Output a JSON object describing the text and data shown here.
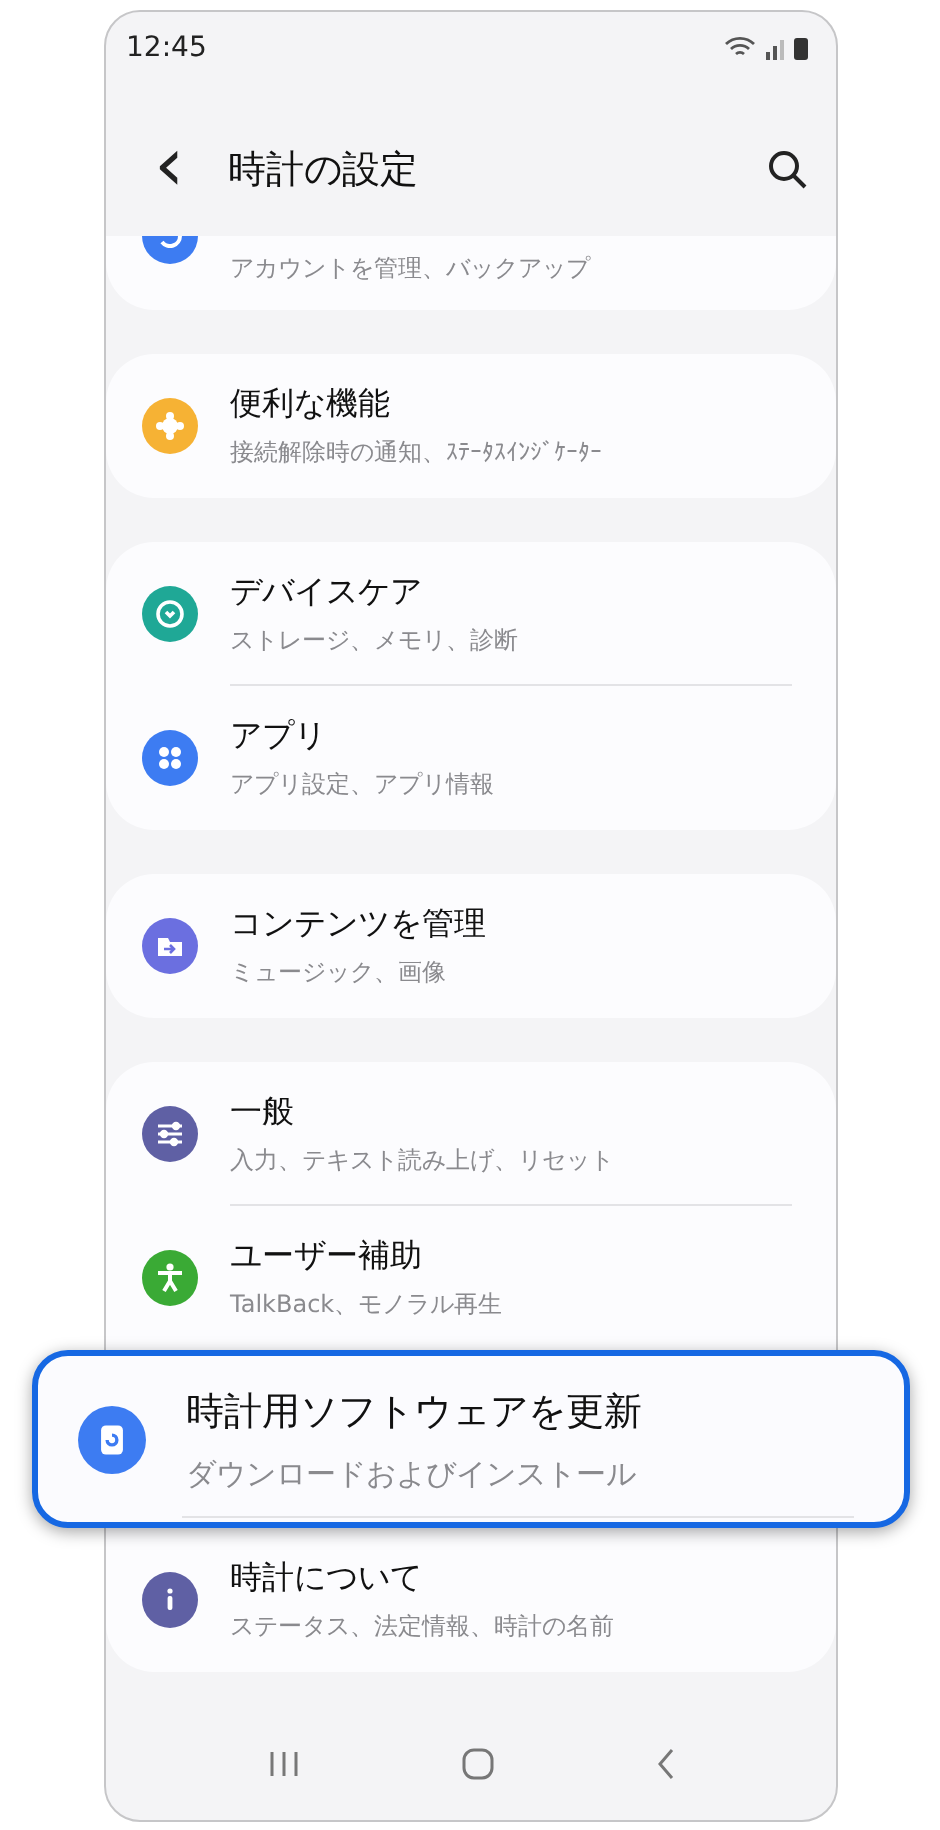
{
  "status_bar": {
    "time": "12:45"
  },
  "header": {
    "back": "‹",
    "title": "時計の設定"
  },
  "groups": [
    {
      "items": [
        {
          "subtitle": "アカウントを管理、バックアップ",
          "color": "#3d7cf2",
          "highlighted": false
        }
      ]
    },
    {
      "items": [
        {
          "title": "便利な機能",
          "subtitle": "接続解除時の通知、ｽﾃｰﾀｽｲﾝｼﾞｹｰﾀｰ",
          "color": "#f6b234",
          "highlighted": false
        }
      ]
    },
    {
      "items": [
        {
          "title": "デバイスケア",
          "subtitle": "ストレージ、メモリ、診断",
          "color": "#1fa896",
          "highlighted": false
        },
        {
          "title": "アプリ",
          "subtitle": "アプリ設定、アプリ情報",
          "color": "#3d7cf2",
          "highlighted": false
        }
      ]
    },
    {
      "items": [
        {
          "title": "コンテンツを管理",
          "subtitle": "ミュージック、画像",
          "color": "#6b6fe0",
          "highlighted": false
        }
      ]
    },
    {
      "items": [
        {
          "title": "一般",
          "subtitle": "入力、テキスト読み上げ、リセット",
          "color": "#5f60a4",
          "highlighted": false
        },
        {
          "title": "ユーザー補助",
          "subtitle": "TalkBack、モノラル再生",
          "color": "#3aaa35",
          "highlighted": false
        },
        {
          "title": "時計用ソフトウェアを更新",
          "subtitle": "ダウンロードおよびインストール",
          "color": "#3d7cf2",
          "highlighted": true
        },
        {
          "title": "時計について",
          "subtitle": "ステータス、法定情報、時計の名前",
          "color": "#5f60a4",
          "highlighted": false
        }
      ]
    }
  ]
}
